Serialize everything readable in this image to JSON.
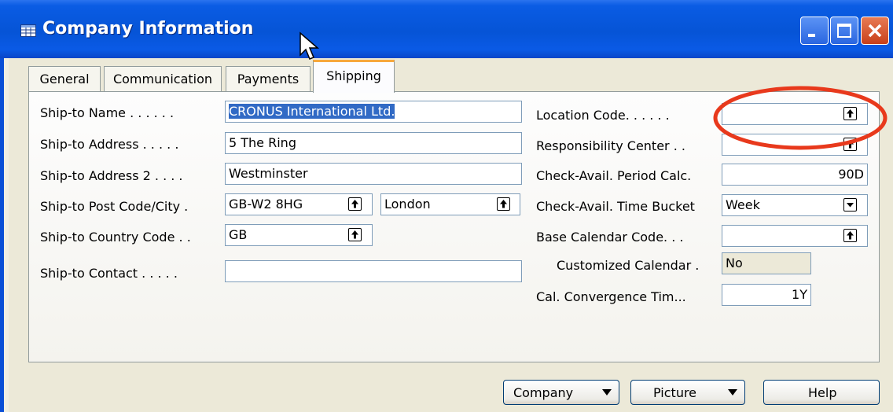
{
  "window": {
    "title": "Company Information"
  },
  "tabs": [
    {
      "label": "General"
    },
    {
      "label": "Communication"
    },
    {
      "label": "Payments"
    },
    {
      "label": "Shipping",
      "active": true
    }
  ],
  "left_fields": {
    "ship_to_name": {
      "label": "Ship-to Name . . . . . .",
      "value": "CRONUS International Ltd."
    },
    "ship_to_address": {
      "label": "Ship-to Address . . . . .",
      "value": "5 The Ring"
    },
    "ship_to_address2": {
      "label": "Ship-to Address 2 . . . .",
      "value": "Westminster"
    },
    "ship_to_post_city": {
      "label": "Ship-to Post Code/City  .",
      "post_code": "GB-W2 8HG",
      "city": "London"
    },
    "ship_to_country": {
      "label": "Ship-to Country Code . .",
      "value": "GB"
    },
    "ship_to_contact": {
      "label": "Ship-to Contact . . . . .",
      "value": ""
    }
  },
  "right_fields": {
    "location_code": {
      "label": "Location Code. . . . . .",
      "value": ""
    },
    "responsibility_center": {
      "label": "Responsibility Center  . .",
      "value": ""
    },
    "check_avail_period": {
      "label": "Check-Avail. Period Calc.",
      "value": "90D"
    },
    "check_avail_bucket": {
      "label": "Check-Avail. Time Bucket",
      "value": "Week"
    },
    "base_calendar": {
      "label": "Base Calendar Code. . .",
      "value": ""
    },
    "customized_calendar": {
      "label": "Customized Calendar  .",
      "value": "No"
    },
    "cal_convergence": {
      "label": "Cal. Convergence Tim...",
      "value": "1Y"
    }
  },
  "buttons": {
    "company": "Company",
    "picture": "Picture",
    "help": "Help"
  },
  "colors": {
    "titlebar": "#0654d6",
    "selection": "#316ac5",
    "annotation": "#e8391c",
    "active_tab_accent": "#f7a83c"
  },
  "icons": {
    "window": "table-icon",
    "lookup": "lookup-arrow-icon",
    "dropdown": "dropdown-icon"
  }
}
